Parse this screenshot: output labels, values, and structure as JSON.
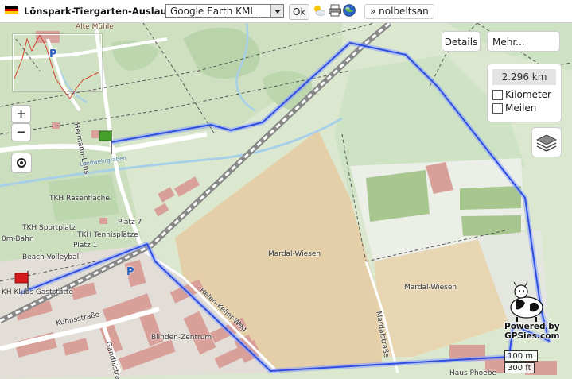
{
  "toolbar": {
    "title": "Lönspark-Tiergarten-Auslauf...",
    "format_select": "Google Earth KML",
    "ok_label": "Ok",
    "user_label": "» nolbeltsan",
    "flag_colors": [
      "#000000",
      "#dd0000",
      "#ffce00"
    ]
  },
  "map": {
    "labels": {
      "alte_muehle": "Alte Mühle",
      "parking1": "P",
      "parking2": "P",
      "hermann": "Hermann-Löns",
      "landwehr": "Landwehrgraben",
      "rasenflaeche": "TKH Rasenfläche",
      "sportplatz": "TKH Sportplatz",
      "tennis": "TKH Tennisplätze",
      "platz7": "Platz 7",
      "platz1": "Platz 1",
      "bahn": "0m-Bahn",
      "beach": "Beach-Volleyball",
      "gaststaette": "KH Klubs Gaststätte",
      "kuhnsstrasse": "Kuhnsstraße",
      "gandhistrasse": "Gandhistraße",
      "blinden": "Blinden-Zentrum",
      "helen": "Helen-Keller-Weg",
      "mardal1": "Mardal-Wiesen",
      "mardal2": "Mardal-Wiesen",
      "mardalstrasse": "Mardalstraße",
      "haus_phoebe": "Haus Phoebe"
    },
    "controls": {
      "zoom_in": "+",
      "zoom_out": "−",
      "details": "Details",
      "more": "Mehr...",
      "distance": "2.296 km",
      "unit_km": "Kilometer",
      "unit_mi": "Meilen"
    },
    "branding": {
      "line1": "Powered by",
      "line2": "GPSies.com"
    },
    "scale": {
      "metric": "100 m",
      "imperial": "300 ft"
    },
    "colors": {
      "track": "#2f4fe0",
      "track_glow": "#8aa0ff",
      "park": "#cfe2bf",
      "wood": "#a9c99a",
      "field": "#e6d0ab",
      "building": "#d9a09a",
      "water": "#a7d0e8"
    }
  }
}
